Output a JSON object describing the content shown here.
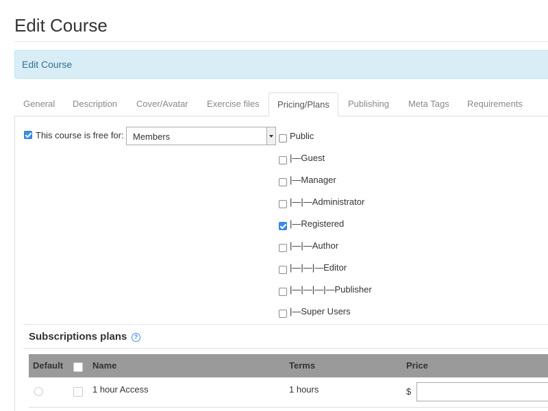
{
  "page": {
    "title": "Edit Course"
  },
  "banner": {
    "text": "Edit Course"
  },
  "tabs": [
    {
      "label": "General"
    },
    {
      "label": "Description"
    },
    {
      "label": "Cover/Avatar"
    },
    {
      "label": "Exercise files"
    },
    {
      "label": "Pricing/Plans",
      "active": true
    },
    {
      "label": "Publishing"
    },
    {
      "label": "Meta Tags"
    },
    {
      "label": "Requirements"
    }
  ],
  "free_for": {
    "checked": true,
    "label": "This course is free for:",
    "selected": "Members"
  },
  "groups": [
    {
      "label": "Public",
      "checked": false
    },
    {
      "label": "|—Guest",
      "checked": false
    },
    {
      "label": "|—Manager",
      "checked": false
    },
    {
      "label": "|—|—Administrator",
      "checked": false
    },
    {
      "label": "|—Registered",
      "checked": true
    },
    {
      "label": "|—|—Author",
      "checked": false
    },
    {
      "label": "|—|—|—Editor",
      "checked": false
    },
    {
      "label": "|—|—|—|—Publisher",
      "checked": false
    },
    {
      "label": "|—Super Users",
      "checked": false
    }
  ],
  "subscriptions": {
    "title": "Subscriptions plans",
    "help_icon": "question-circle-icon",
    "columns": {
      "default": "Default",
      "name": "Name",
      "terms": "Terms",
      "price": "Price"
    },
    "rows": [
      {
        "name": "1 hour Access",
        "terms": "1 hours",
        "currency": "$",
        "price": ""
      }
    ]
  },
  "colors": {
    "banner_bg": "#d9edf7",
    "banner_text": "#31708f",
    "checkbox_checked": "#3b8eea",
    "table_header": "#9a9a9a"
  }
}
